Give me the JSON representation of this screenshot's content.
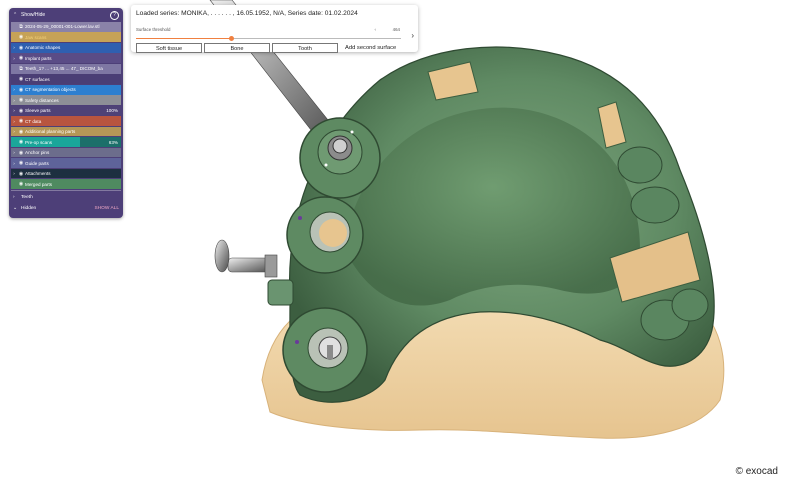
{
  "panel": {
    "header_label": "Show/Hide",
    "help_icon": "?",
    "rows": [
      {
        "label": "2024-05-29_00001-001-Lower.lav.stl",
        "bg": "#8a82a8",
        "text": "#ffffff",
        "arrow": "",
        "eye": "scan-icon"
      },
      {
        "label": "Jaw scans",
        "bg": "#c6a257",
        "text": "#f4d27a",
        "arrow": "",
        "eye": "eye-icon"
      },
      {
        "label": "Anatomic shapes",
        "bg": "#2f5fb0",
        "text": "#ffffff",
        "arrow": "›",
        "eye": "eye-icon"
      },
      {
        "label": "Implant parts",
        "bg": "#5a4c86",
        "text": "#ffffff",
        "arrow": "›",
        "eye": "eye-icon"
      },
      {
        "label": "Teeth_1? ... +13,45 ... 47_ DICOM_ba",
        "bg": "#7e77a3",
        "text": "#ffffff",
        "arrow": "",
        "eye": "scan-icon"
      },
      {
        "label": "CT surfaces",
        "bg": "#4a3e75",
        "text": "#ffffff",
        "arrow": "",
        "eye": "eye-icon"
      },
      {
        "label": "CT segmentation objects",
        "bg": "#2d7fd0",
        "text": "#ffffff",
        "arrow": "›",
        "eye": "eye-icon"
      },
      {
        "label": "Safety distances",
        "bg": "#8d8f97",
        "text": "#ffffff",
        "arrow": "›",
        "eye": "eye-icon"
      },
      {
        "label": "Sleeve parts",
        "bg": "#4e4277",
        "text": "#ffffff",
        "arrow": "›",
        "eye": "eye-icon",
        "pct": "100%"
      },
      {
        "label": "CT data",
        "bg": "#b8553f",
        "text": "#ffffff",
        "arrow": "›",
        "eye": "eye-icon"
      },
      {
        "label": "Additional planning parts",
        "bg": "#b49757",
        "text": "#ffffff",
        "arrow": "›",
        "eye": "eye-icon"
      },
      {
        "label": "Pre-op scans",
        "bg": "#1aa69a",
        "text": "#ffffff",
        "arrow": "",
        "eye": "eye-icon",
        "pct": "63%",
        "fill": 0.63
      },
      {
        "label": "Anchor pins",
        "bg": "#6c6d8c",
        "text": "#ffffff",
        "arrow": "›",
        "eye": "eye-icon"
      },
      {
        "label": "Guide parts",
        "bg": "#5e639a",
        "text": "#ffffff",
        "arrow": "›",
        "eye": "eye-icon"
      },
      {
        "label": "Attachments",
        "bg": "#1d2f40",
        "text": "#ffffff",
        "arrow": "›",
        "eye": "eye-icon"
      },
      {
        "label": "Merged parts",
        "bg": "#4f8a60",
        "text": "#ffffff",
        "arrow": "",
        "eye": "eye-icon"
      }
    ],
    "teeth_label": "Teeth",
    "hidden_label": "Hidden",
    "show_all_label": "SHOW ALL"
  },
  "series": {
    "loaded_text": "Loaded series: MONIKA, . . . . . . , 16.05.1952, N/A, Series date: 01.02.2024",
    "threshold_label": "Surface threshold",
    "threshold_value": "464",
    "threshold_fraction": 0.36,
    "buttons": [
      "Soft tissue",
      "Bone",
      "Tooth"
    ],
    "add_label": "Add second surface"
  },
  "copyright": "© exocad",
  "colors": {
    "gum": "#5f8a63",
    "bone": "#efd3a6",
    "guide_dark": "#3f5e42"
  }
}
